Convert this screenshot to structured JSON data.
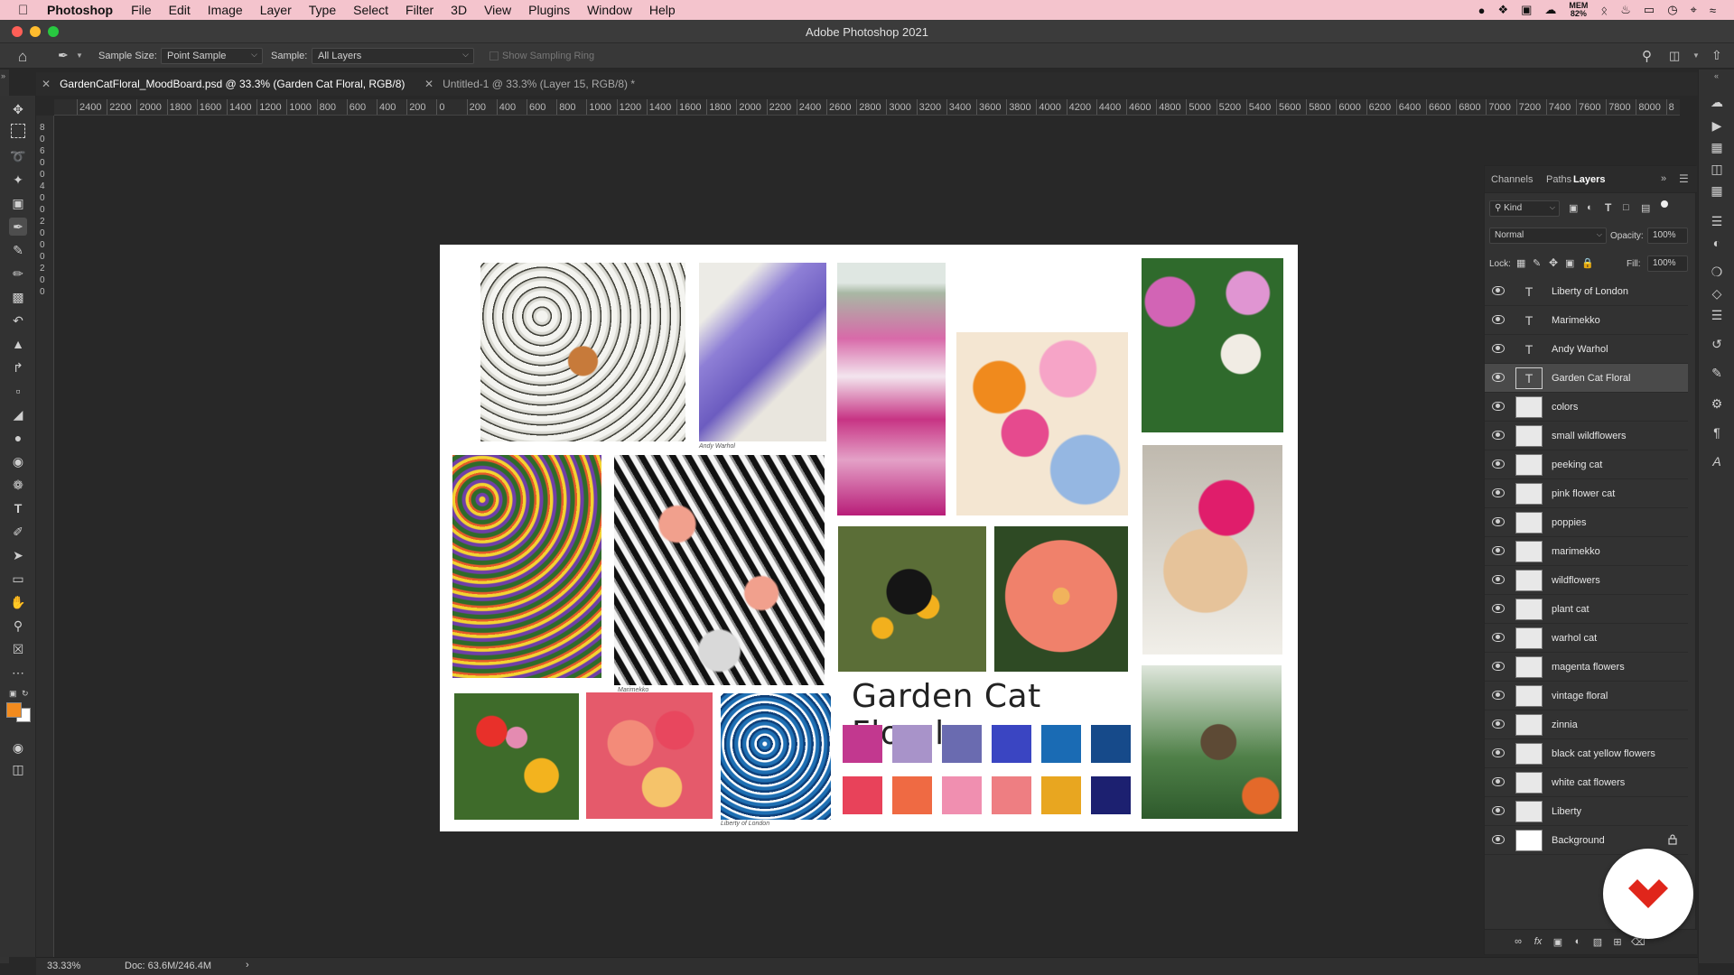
{
  "menubar": {
    "app_name": "Photoshop",
    "menus": [
      "File",
      "Edit",
      "Image",
      "Layer",
      "Type",
      "Select",
      "Filter",
      "3D",
      "View",
      "Plugins",
      "Window",
      "Help"
    ],
    "mem_label": "MEM",
    "mem_value": "82%"
  },
  "window": {
    "title": "Adobe Photoshop 2021"
  },
  "options": {
    "sample_size_label": "Sample Size:",
    "sample_size_value": "Point Sample",
    "sample_label": "Sample:",
    "sample_value": "All Layers",
    "sampling_ring_label": "Show Sampling Ring"
  },
  "tabs": [
    {
      "label": "GardenCatFloral_MoodBoard.psd @ 33.3% (Garden Cat Floral, RGB/8)",
      "active": true
    },
    {
      "label": "Untitled-1 @ 33.3% (Layer 15, RGB/8) *",
      "active": false
    }
  ],
  "ruler_top": [
    "2400",
    "2200",
    "2000",
    "1800",
    "1600",
    "1400",
    "1200",
    "1000",
    "800",
    "600",
    "400",
    "200",
    "0",
    "200",
    "400",
    "600",
    "800",
    "1000",
    "1200",
    "1400",
    "1600",
    "1800",
    "2000",
    "2200",
    "2400",
    "2600",
    "2800",
    "3000",
    "3200",
    "3400",
    "3600",
    "3800",
    "4000",
    "4200",
    "4400",
    "4600",
    "4800",
    "5000",
    "5200",
    "5400",
    "5600",
    "5800",
    "6000",
    "6200",
    "6400",
    "6600",
    "6800",
    "7000",
    "7200",
    "7400",
    "7600",
    "7800",
    "8000",
    "8"
  ],
  "ruler_left": [
    "8",
    "0",
    "6",
    "0",
    "0",
    "4",
    "0",
    "0",
    "2",
    "0",
    "0",
    "0",
    "2",
    "0",
    "0"
  ],
  "moodboard": {
    "title": "Garden Cat Floral",
    "captions": {
      "warhol": "Andy Warhol",
      "marimekko": "Marimekko",
      "liberty": "Liberty of London"
    },
    "colors": [
      "#c2388f",
      "#a893c9",
      "#6a6bb0",
      "#3a45c2",
      "#1a6bb4",
      "#164a8a",
      "#e8425a",
      "#ef6a43",
      "#f08fb0",
      "#ee7e82",
      "#e8a620",
      "#1c2070"
    ]
  },
  "layers_panel": {
    "tabs": [
      "Channels",
      "Paths",
      "Layers"
    ],
    "kind_label": "Kind",
    "blend_mode": "Normal",
    "opacity_label": "Opacity:",
    "opacity_value": "100%",
    "lock_label": "Lock:",
    "fill_label": "Fill:",
    "fill_value": "100%",
    "layers": [
      {
        "name": "Liberty of London",
        "type": "text"
      },
      {
        "name": "Marimekko",
        "type": "text"
      },
      {
        "name": "Andy Warhol",
        "type": "text"
      },
      {
        "name": "Garden Cat Floral",
        "type": "text",
        "selected": true
      },
      {
        "name": "colors",
        "type": "image"
      },
      {
        "name": "small wildflowers",
        "type": "image"
      },
      {
        "name": "peeking cat",
        "type": "image"
      },
      {
        "name": "pink flower cat",
        "type": "image"
      },
      {
        "name": "poppies",
        "type": "image"
      },
      {
        "name": "marimekko",
        "type": "image"
      },
      {
        "name": "wildflowers",
        "type": "image"
      },
      {
        "name": "plant cat",
        "type": "image"
      },
      {
        "name": "warhol cat",
        "type": "image"
      },
      {
        "name": "magenta flowers",
        "type": "image"
      },
      {
        "name": "vintage floral",
        "type": "image"
      },
      {
        "name": "zinnia",
        "type": "image"
      },
      {
        "name": "black cat yellow flowers",
        "type": "image"
      },
      {
        "name": "white cat flowers",
        "type": "image"
      },
      {
        "name": "Liberty",
        "type": "image"
      },
      {
        "name": "Background",
        "type": "background",
        "locked": true
      }
    ]
  },
  "statusbar": {
    "zoom": "33.33%",
    "doc": "Doc: 63.6M/246.4M"
  },
  "badge_color": "#e0261b"
}
